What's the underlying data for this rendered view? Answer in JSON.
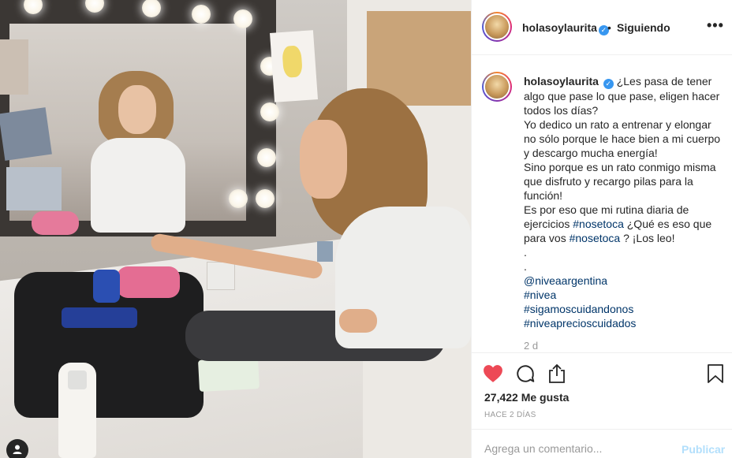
{
  "post": {
    "username": "holasoylaurita",
    "separator": "•",
    "follow_status": "Siguiendo",
    "more_icon": "more-icon"
  },
  "caption": {
    "username": "holasoylaurita",
    "line_1": "¿Les pasa de tener algo que pase lo que pase, eligen hacer todos los días?",
    "line_2": "Yo dedico un rato a entrenar y elongar no sólo porque le hace bien a mi cuerpo y descargo mucha energía!",
    "line_3": "Sino porque es un rato conmigo misma que disfruto y recargo pilas para la función!",
    "line_4_a": "Es por eso que mi rutina diaria de ejercicios ",
    "hashtag_1": "#nosetoca",
    "line_4_b": " ¿Qué es eso que para vos ",
    "hashtag_2": "#nosetoca",
    "line_4_c": " ? ¡Los leo!",
    "dot_1": ".",
    "dot_2": ".",
    "mention": "@niveaargentina",
    "tag_a": "#nivea",
    "tag_b": "#sigamoscuidandonos",
    "tag_c": "#niveaprecioscuidados",
    "time_ago": "2 d"
  },
  "stats": {
    "likes": "27,422 Me gusta",
    "posted": "HACE 2 DÍAS"
  },
  "comment": {
    "placeholder": "Agrega un comentario...",
    "publish_label": "Publicar"
  },
  "colors": {
    "heart": "#ed4956",
    "link": "#003569",
    "verified": "#3897f0",
    "publish_disabled": "#b2dffc"
  }
}
